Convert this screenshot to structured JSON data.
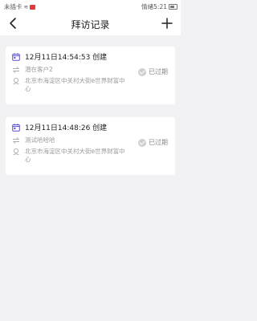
{
  "status_bar": {
    "left_text": "未插卡",
    "right_text": "情绪5:21"
  },
  "header": {
    "title": "拜访记录"
  },
  "records": [
    {
      "time": "12月11日14:54:53 创建",
      "customer": "潜在客户2",
      "address": "北京市海淀区中关村大街e世界财富中心",
      "status": "已过期"
    },
    {
      "time": "12月11日14:48:26 创建",
      "customer": "测试哈哈哈",
      "address": "北京市海淀区中关村大街e世界财富中心",
      "status": "已过期"
    }
  ],
  "colors": {
    "calendar_icon": "#5a4fd6",
    "background": "#f2f2f4"
  }
}
